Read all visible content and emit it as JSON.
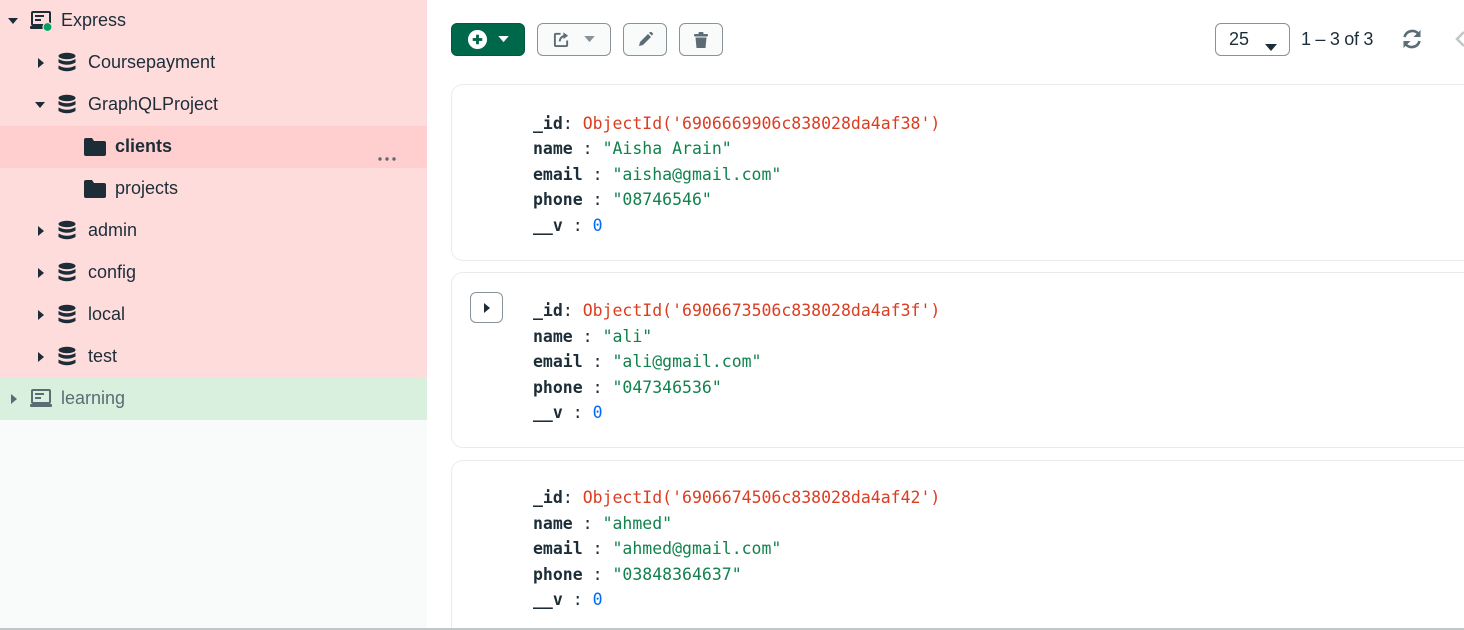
{
  "sidebar": {
    "connections": [
      {
        "name": "Express",
        "status": "connected"
      },
      {
        "name": "learning"
      }
    ],
    "databases": [
      "Coursepayment",
      "GraphQLProject",
      "admin",
      "config",
      "local",
      "test"
    ],
    "collections": [
      "clients",
      "projects"
    ],
    "selected_collection": "clients"
  },
  "toolbar": {
    "page_size": "25",
    "pagination_text": "1 – 3 of 3"
  },
  "documents": [
    {
      "fields": [
        {
          "key": "_id",
          "value": "ObjectId('6906669906c838028da4af38')",
          "type": "oid"
        },
        {
          "key": "name",
          "value": "\"Aisha Arain\"",
          "type": "str"
        },
        {
          "key": "email",
          "value": "\"aisha@gmail.com\"",
          "type": "str"
        },
        {
          "key": "phone",
          "value": "\"08746546\"",
          "type": "str"
        },
        {
          "key": "__v",
          "value": "0",
          "type": "num"
        }
      ]
    },
    {
      "fields": [
        {
          "key": "_id",
          "value": "ObjectId('6906673506c838028da4af3f')",
          "type": "oid"
        },
        {
          "key": "name",
          "value": "\"ali\"",
          "type": "str"
        },
        {
          "key": "email",
          "value": "\"ali@gmail.com\"",
          "type": "str"
        },
        {
          "key": "phone",
          "value": "\"047346536\"",
          "type": "str"
        },
        {
          "key": "__v",
          "value": "0",
          "type": "num"
        }
      ]
    },
    {
      "fields": [
        {
          "key": "_id",
          "value": "ObjectId('6906674506c838028da4af42')",
          "type": "oid"
        },
        {
          "key": "name",
          "value": "\"ahmed\"",
          "type": "str"
        },
        {
          "key": "email",
          "value": "\"ahmed@gmail.com\"",
          "type": "str"
        },
        {
          "key": "phone",
          "value": "\"03848364637\"",
          "type": "str"
        },
        {
          "key": "__v",
          "value": "0",
          "type": "num"
        }
      ]
    }
  ],
  "icons": {
    "connection": "laptop-icon",
    "database": "database-icon",
    "collection": "folder-icon",
    "add": "plus-circle-icon",
    "export": "export-icon",
    "edit": "pencil-icon",
    "delete": "trash-icon",
    "refresh": "refresh-icon",
    "more": "ellipsis-icon"
  },
  "colors": {
    "accent_green": "#00684a",
    "connection_pink": "#ffdcdc",
    "connection_green": "#d9f0df",
    "objectid_red": "#db3d21",
    "string_green": "#12824d",
    "number_blue": "#016bf8"
  }
}
